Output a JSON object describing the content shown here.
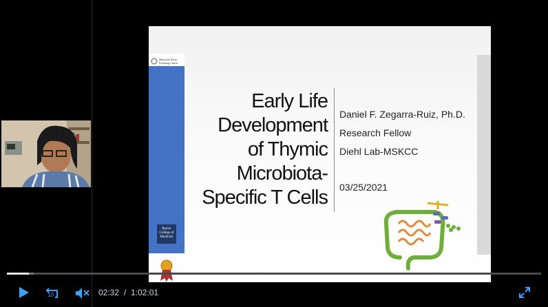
{
  "slide": {
    "title_lines": [
      "Early Life",
      "Development",
      "of Thymic",
      "Microbiota-",
      "Specific T Cells"
    ],
    "presenter": "Daniel F. Zegarra-Ruiz, Ph.D.",
    "role": "Research Fellow",
    "lab": "Diehl Lab-MSKCC",
    "date": "03/25/2021",
    "logo_top": "Memorial Sloan Kettering Cancer Center",
    "logo_bottom": "Baylor College of Medicine"
  },
  "player": {
    "current_time": "02:32",
    "separator": "/",
    "duration": "1:02:01",
    "progress_fraction": 0.041,
    "buffered_fraction": 0.05,
    "rewind_seconds": "10",
    "icons": [
      "play-icon",
      "rewind-10-icon",
      "mute-icon",
      "fullscreen-icon"
    ],
    "accent": "#39a2ff"
  }
}
